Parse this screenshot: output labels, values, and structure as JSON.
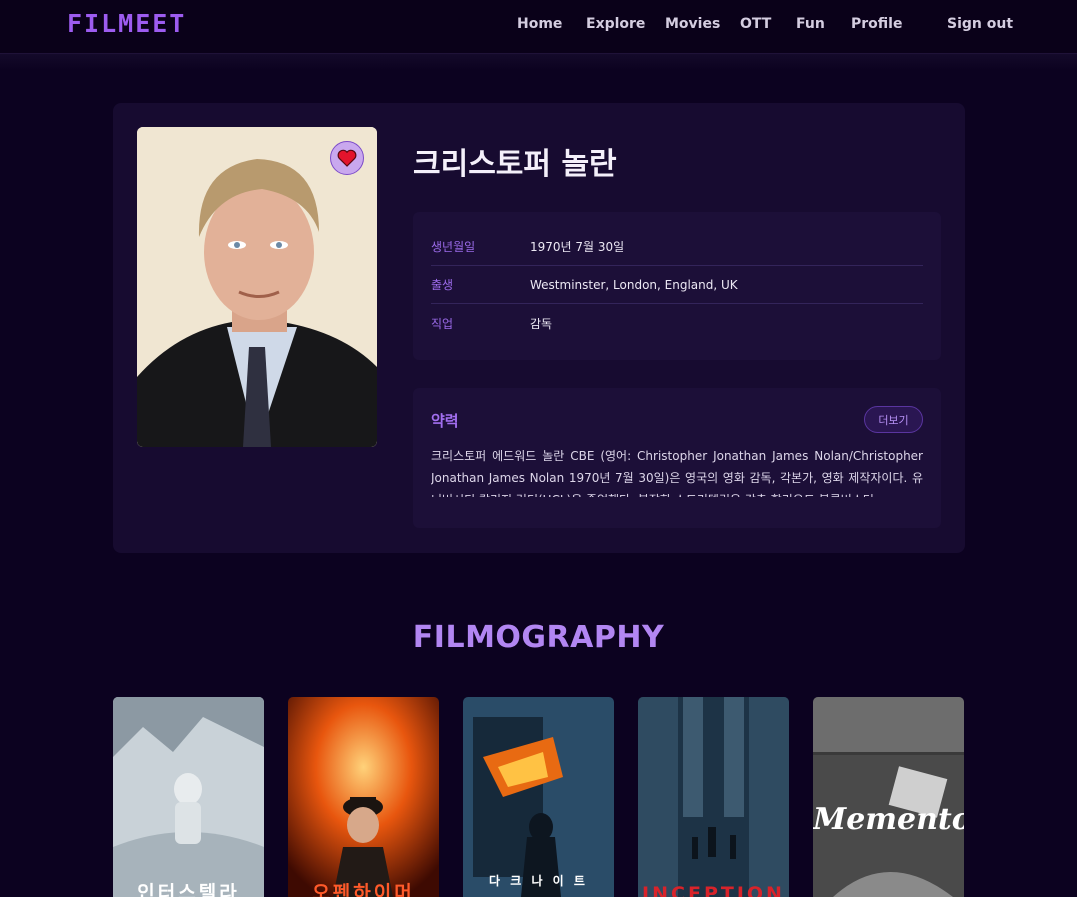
{
  "brand": {
    "logo": "FILMEET"
  },
  "nav": {
    "links": [
      "Home",
      "Explore",
      "Movies",
      "OTT",
      "Fun",
      "Profile"
    ],
    "signout": "Sign out"
  },
  "person": {
    "name": "크리스토퍼 놀란",
    "info": [
      {
        "label": "생년월일",
        "value": "1970년 7월 30일"
      },
      {
        "label": "출생",
        "value": "Westminster, London, England, UK"
      },
      {
        "label": "직업",
        "value": "감독"
      }
    ],
    "bio_title": "약력",
    "more_label": "더보기",
    "bio": "크리스토퍼 에드워드 놀란 CBE (영어: Christopher Jonathan James Nolan/Christopher Jonathan James Nolan 1970년 7월 30일)은 영국의 영화 감독, 각본가, 영화 제작자이다. 유니버시티 칼리지 런던(UCL)을 졸업했다. 복잡한 스토리텔링은 갖춘 할리우드 블록버스터"
  },
  "filmography": {
    "title": "FILMOGRAPHY",
    "posters": [
      {
        "name": "interstellar",
        "title": "인터스텔라",
        "bg": "#c9d2d8",
        "accent": "#7e8c96",
        "text": "#ffffff"
      },
      {
        "name": "oppenheimer",
        "title": "오펜하이머",
        "bg": "#7a1a06",
        "accent": "#f08a1c",
        "text": "#ff5a2a"
      },
      {
        "name": "the-dark-knight",
        "title": "다 크 나 이 트",
        "bg": "#1b3a55",
        "accent": "#e86a12",
        "text": "#ffffff"
      },
      {
        "name": "inception",
        "title": "INCEPTION",
        "bg": "#1d3346",
        "accent": "#6f8aa0",
        "text": "#d8232a"
      },
      {
        "name": "memento",
        "title": "Memento",
        "bg": "#2c2c2c",
        "accent": "#9a9a9a",
        "text": "#ffffff"
      }
    ]
  }
}
